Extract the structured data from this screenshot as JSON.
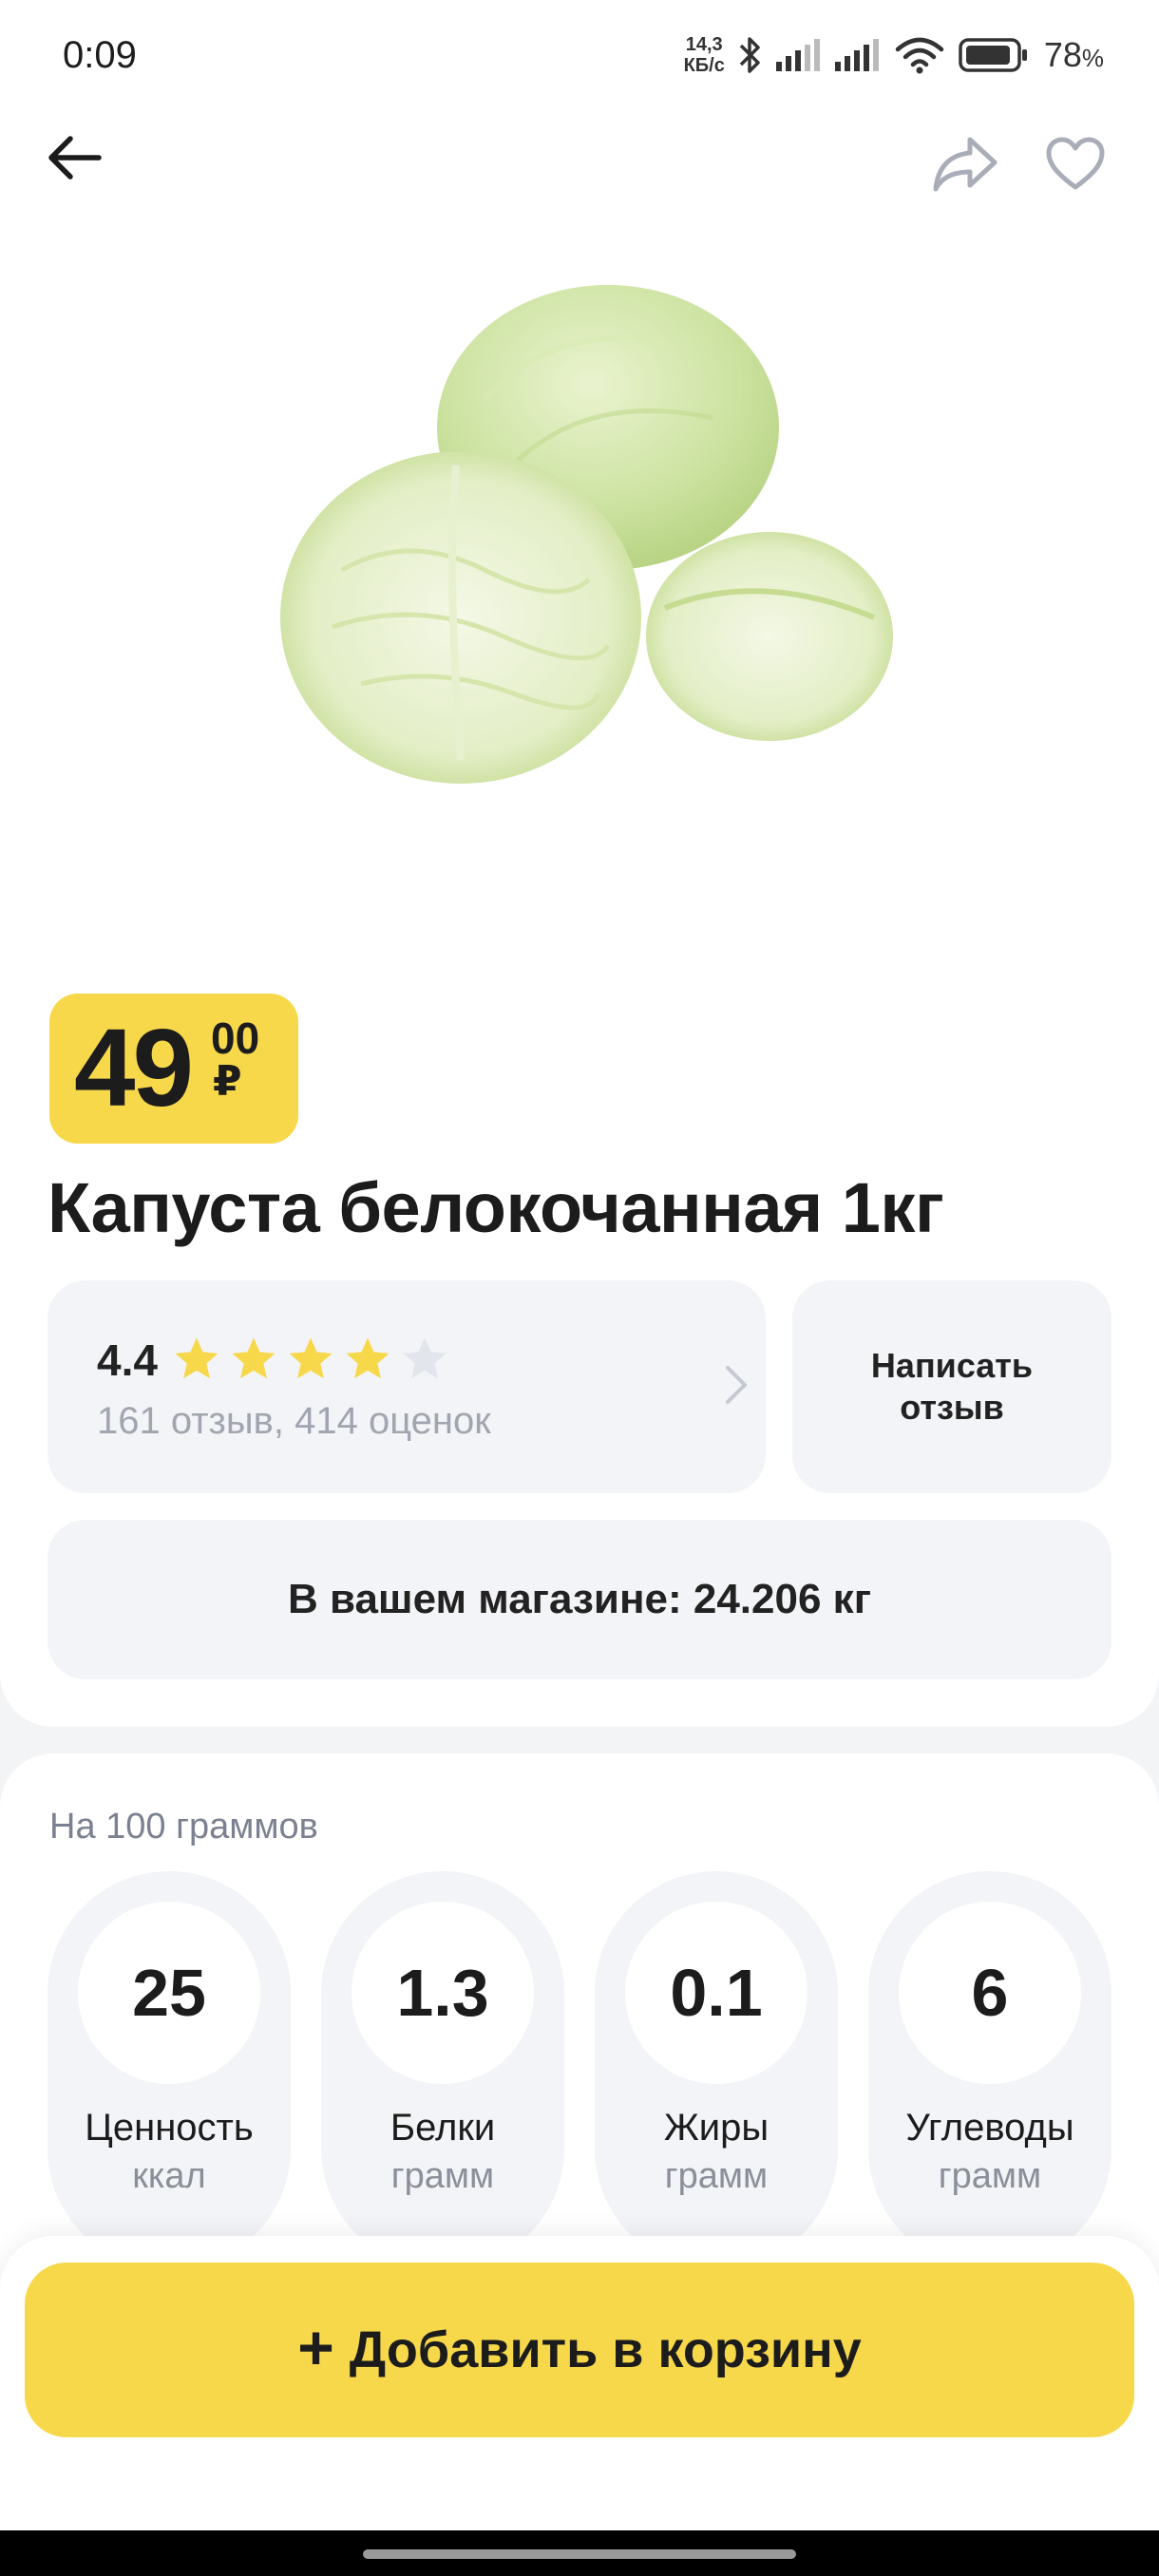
{
  "status_bar": {
    "time": "0:09",
    "net_speed_value": "14,3",
    "net_speed_unit": "КБ/с",
    "battery_percent": "78",
    "battery_sign": "%"
  },
  "product": {
    "price_main": "49",
    "price_cents": "00",
    "currency": "₽",
    "title": "Капуста белокочанная 1кг"
  },
  "rating": {
    "value": "4.4",
    "stars": 4.4,
    "summary": "161 отзыв, 414 оценок",
    "star_color": "#f7d84a",
    "star_empty_color": "#e3e5ec"
  },
  "write_review_label": "Написать отзыв",
  "stock_text": "В вашем магазине: 24.206 кг",
  "nutrition": {
    "caption": "На 100 граммов",
    "items": [
      {
        "value": "25",
        "name": "Ценность",
        "unit": "ккал"
      },
      {
        "value": "1.3",
        "name": "Белки",
        "unit": "грамм"
      },
      {
        "value": "0.1",
        "name": "Жиры",
        "unit": "грамм"
      },
      {
        "value": "6",
        "name": "Углеводы",
        "unit": "грамм"
      }
    ]
  },
  "cart_button": {
    "plus": "+",
    "label": "Добавить в корзину",
    "color": "#f7d84a"
  },
  "icons": {
    "back": "arrow-left-icon",
    "share": "share-arrow-icon",
    "favorite": "heart-outline-icon",
    "bluetooth": "bluetooth-icon",
    "signal": "cellular-signal-icon",
    "wifi": "wifi-icon",
    "battery": "battery-icon",
    "chevron": "chevron-right-icon"
  }
}
